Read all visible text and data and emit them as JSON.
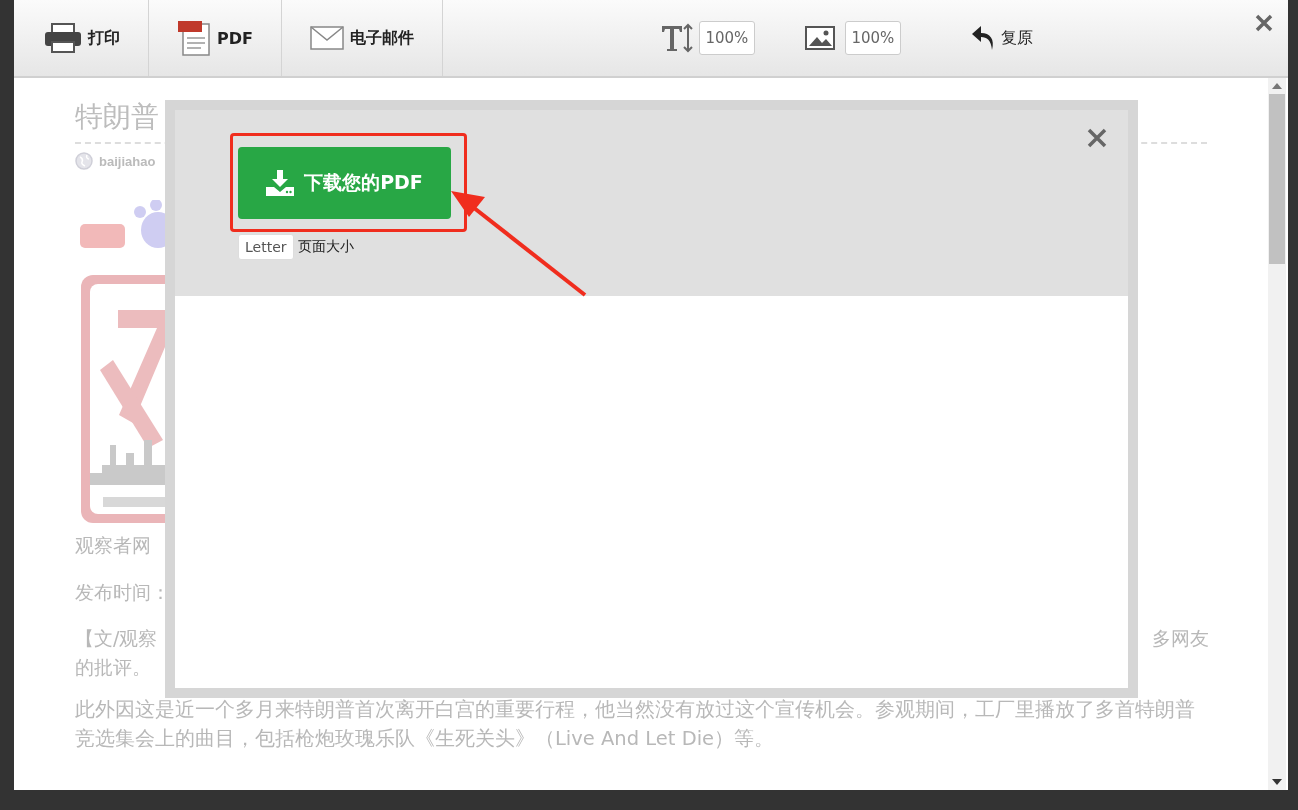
{
  "toolbar": {
    "actions": [
      {
        "kind": "print",
        "label": "打印"
      },
      {
        "kind": "pdf",
        "label": "PDF"
      },
      {
        "kind": "email",
        "label": "电子邮件"
      }
    ],
    "text_size": "100%",
    "image_size": "100%",
    "reset": "复原"
  },
  "article": {
    "title": "特朗普",
    "source": "baijiahao",
    "author": "观察者网",
    "published": "发布时间：",
    "paragraphs": [
      {
        "start": "【文/观察",
        "end": "多网友",
        "continuation": "的批评。"
      }
    ],
    "full_paragraphs": [
      "此外因这是近一个多月来特朗普首次离开白宫的重要行程，他当然没有放过这个宣传机会。参观期间，工厂里播放了多首特朗普竞选集会上的曲目，包括枪炮玫瑰乐队《生死关头》（Live And Let Die）等。"
    ]
  },
  "dialog": {
    "download_button": "下载您的PDF",
    "page_size": "Letter",
    "page_size_label": "页面大小"
  }
}
